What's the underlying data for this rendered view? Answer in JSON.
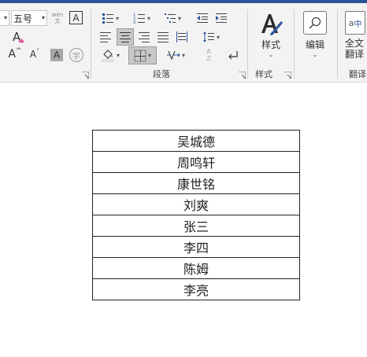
{
  "font": {
    "family_value": "",
    "size_value": "五号"
  },
  "font_buttons": {
    "phonetic_top": "wén",
    "phonetic_bottom": "文",
    "border_char": "A",
    "grow": "A",
    "shrink": "A",
    "shade_char": "A",
    "enclose_char": "字"
  },
  "paragraph": {
    "group_label": "段落",
    "sort_top": "A",
    "sort_bottom": "Z"
  },
  "styles": {
    "label": "样式",
    "group_label": "样式"
  },
  "editing": {
    "label": "编辑"
  },
  "translate": {
    "label_line1": "全文",
    "label_line2": "翻译",
    "group_label": "翻译"
  },
  "table_rows": [
    "吴城德",
    "周鸣轩",
    "康世铭",
    "刘爽",
    "张三",
    "李四",
    "陈姆",
    "李亮"
  ],
  "colors": {
    "accent": "#2b579a",
    "ribbon_bg": "#f3f3f3",
    "selected_bg": "#c8c8c8"
  }
}
